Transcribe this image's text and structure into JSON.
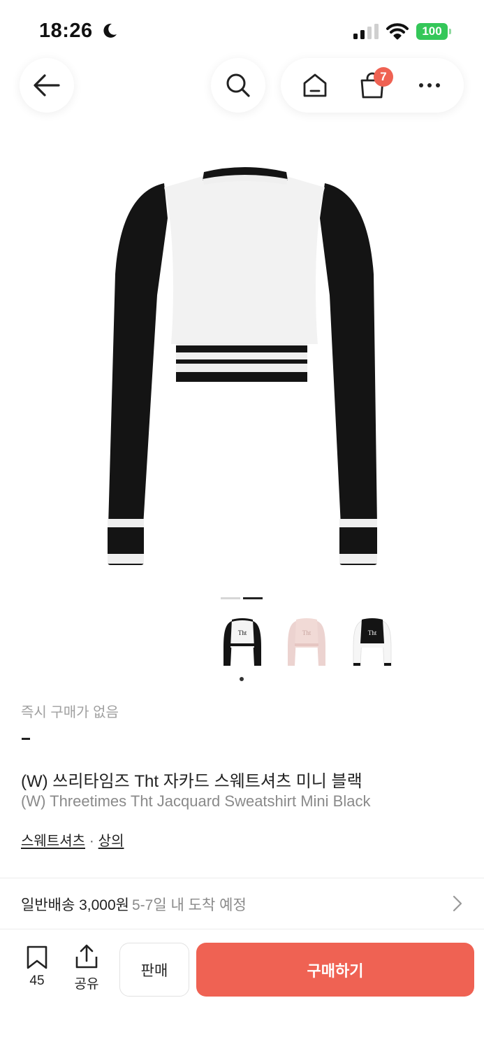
{
  "status_bar": {
    "time": "18:26",
    "battery": "100",
    "icons": [
      "moon-icon",
      "signal-icon",
      "wifi-icon",
      "battery-icon"
    ]
  },
  "nav": {
    "icons": [
      "back-arrow-icon",
      "search-icon",
      "home-icon",
      "shopping-bag-icon",
      "more-icon"
    ],
    "cart_badge": "7"
  },
  "gallery": {
    "pages": 2,
    "active_page": 2,
    "thumbnails": [
      "black",
      "pink",
      "white"
    ],
    "selected_thumbnail": 1
  },
  "product": {
    "instant_label": "즉시 구매가 없음",
    "price": "-",
    "title_ko": "(W) 쓰리타임즈 Tht 자카드 스웨트셔츠 미니 블랙",
    "title_en": "(W) Threetimes Tht Jacquard Sweatshirt Mini Black",
    "categories": [
      "스웨트셔츠",
      "상의"
    ],
    "category_separator": "·"
  },
  "shipping": {
    "label": "일반배송 3,000원",
    "eta": "5-7일 내 도착 예정"
  },
  "bottom_bar": {
    "bookmark_count": "45",
    "share_label": "공유",
    "sell_label": "판매",
    "buy_label": "구매하기"
  },
  "colors": {
    "accent": "#ef6253",
    "battery": "#34c759"
  }
}
